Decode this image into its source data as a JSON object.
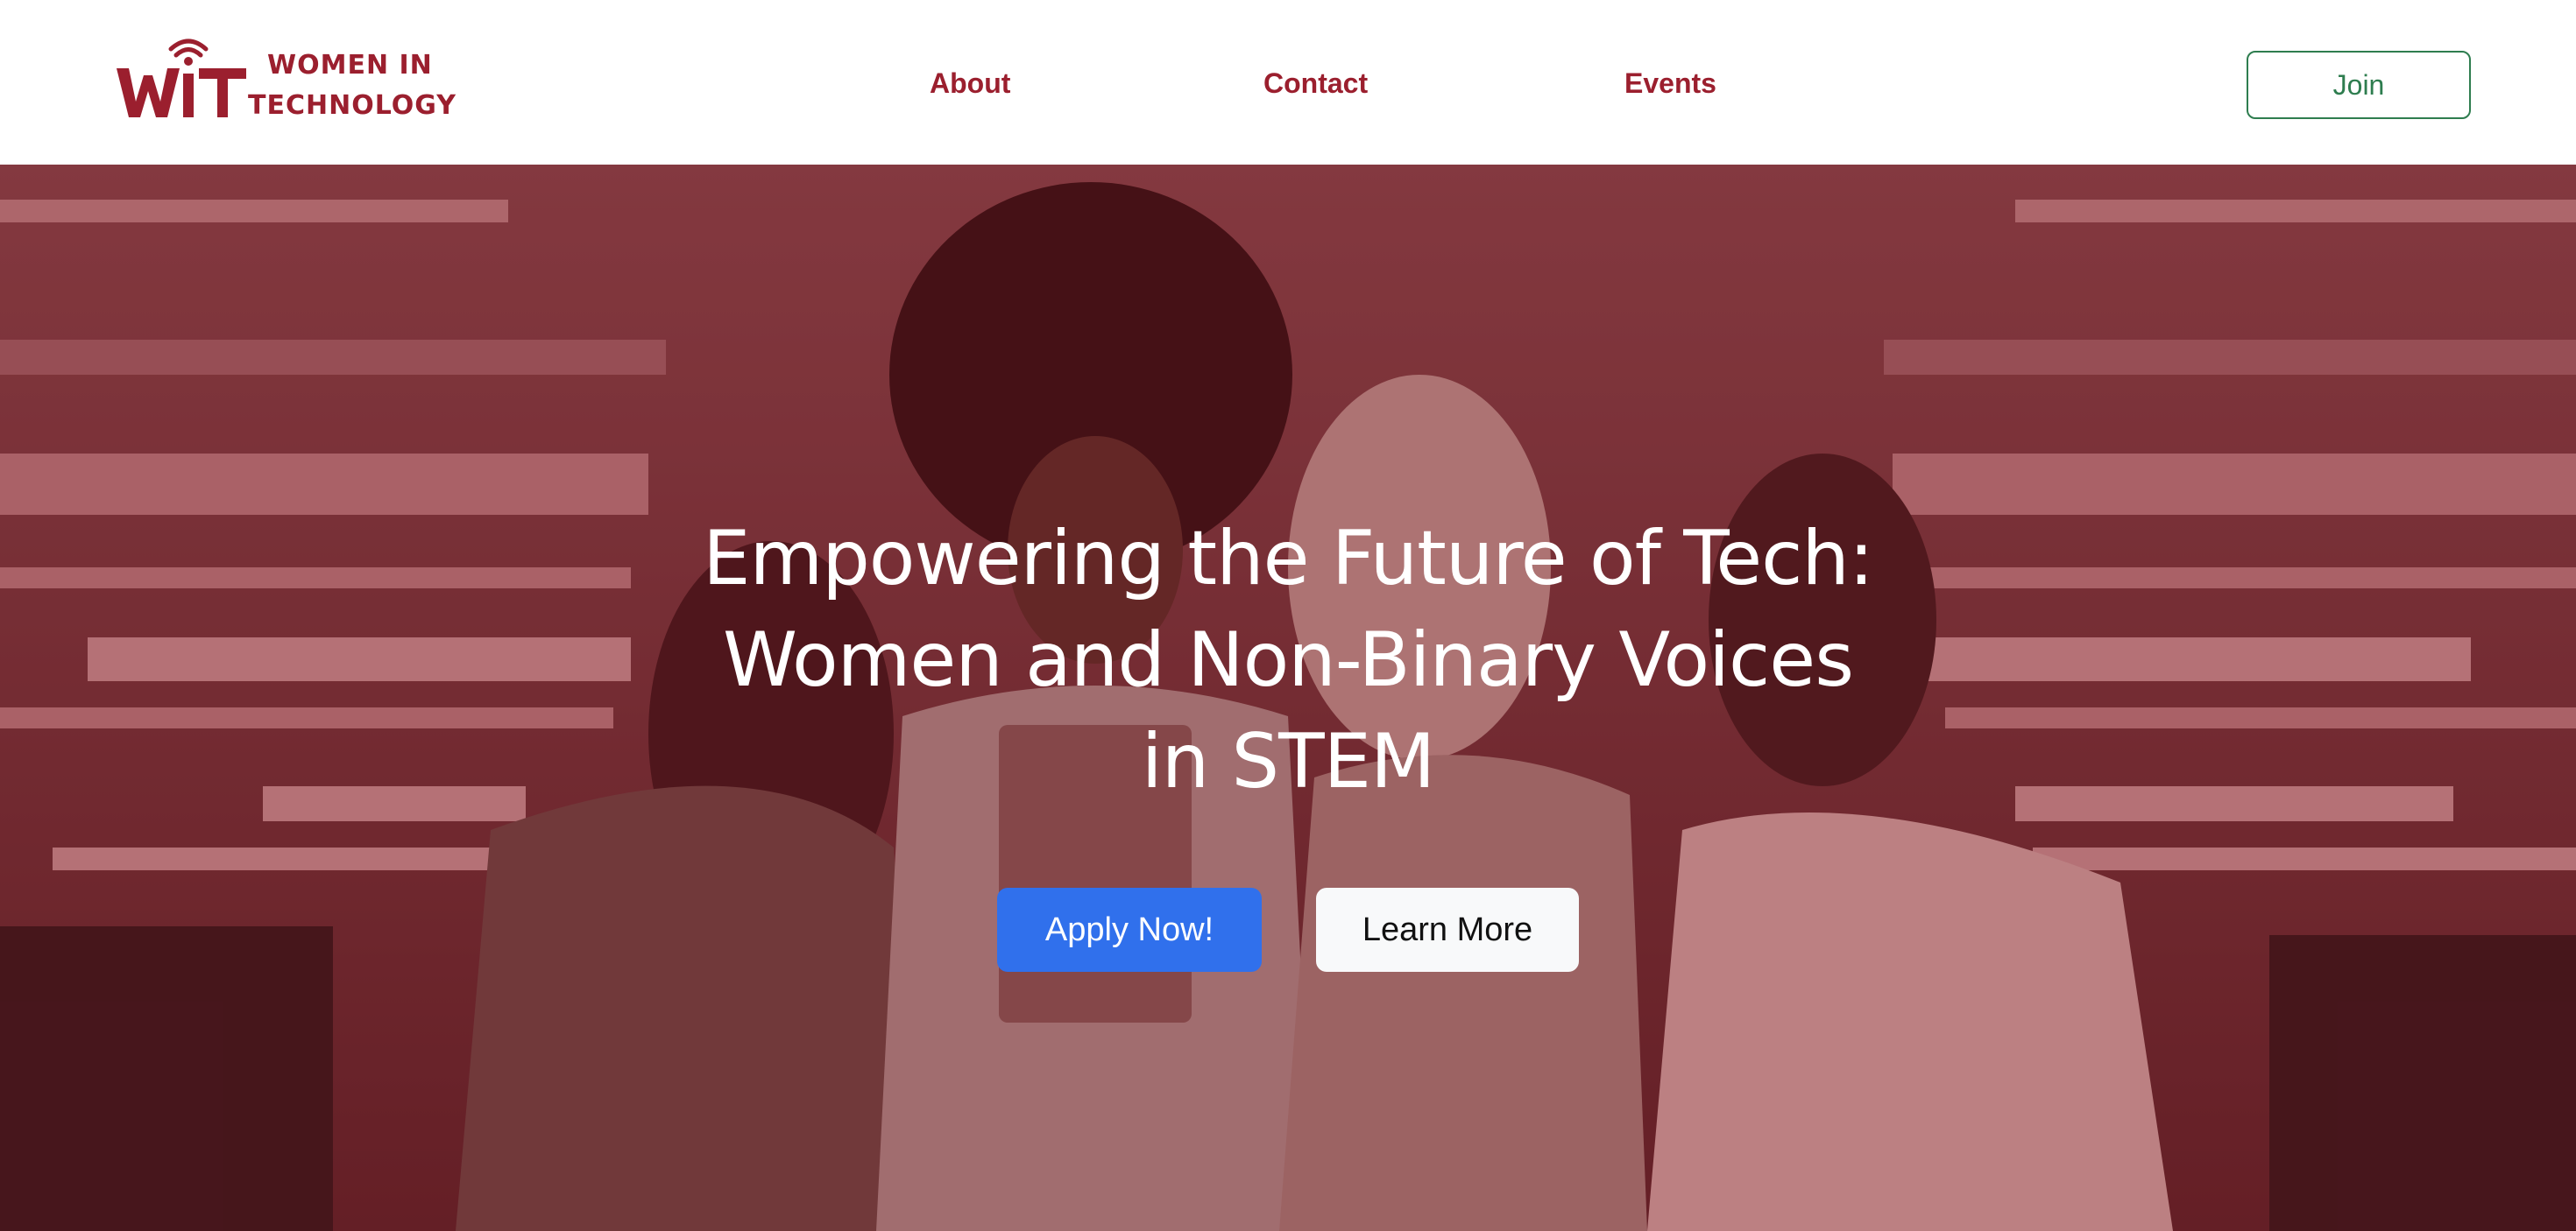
{
  "header": {
    "logo": {
      "mark_text": "WiT",
      "line1": "WOMEN IN",
      "line2": "TECHNOLOGY"
    },
    "nav": [
      {
        "label": "About"
      },
      {
        "label": "Contact"
      },
      {
        "label": "Events"
      }
    ],
    "join_label": "Join"
  },
  "hero": {
    "title": "Empowering the Future of Tech: Women and Non-Binary Voices in STEM",
    "apply_label": "Apply Now!",
    "learn_label": "Learn More"
  },
  "colors": {
    "brand": "#9b1f2e",
    "join_accent": "#2e7d4f",
    "primary_button": "#3070ec",
    "secondary_button": "#f8f9fa",
    "hero_tint": "#7d3b41"
  }
}
